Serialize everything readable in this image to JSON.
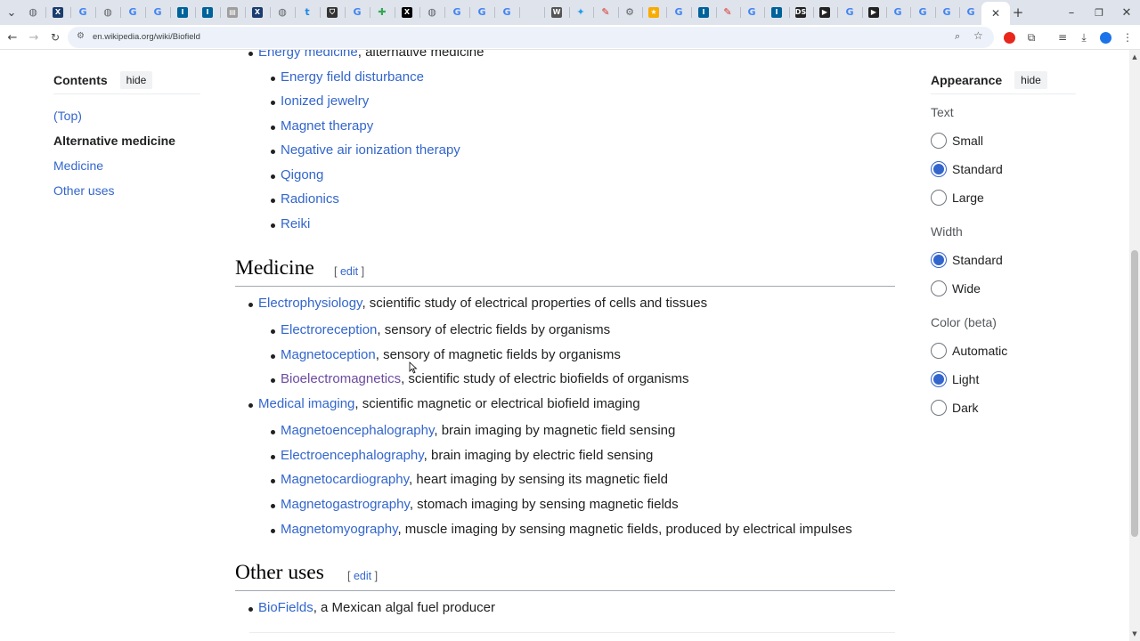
{
  "browser": {
    "url": "en.wikipedia.org/wiki/Biofield",
    "tabs": [
      {
        "icon": "globe-icon",
        "color": "#5f6368",
        "glyph": "◍"
      },
      {
        "icon": "app-x-dark-icon",
        "color": "#1a3c6e",
        "glyph": "X"
      },
      {
        "icon": "google-icon",
        "color": "#4285f4",
        "glyph": "G"
      },
      {
        "icon": "globe-icon",
        "color": "#5f6368",
        "glyph": "◍"
      },
      {
        "icon": "google-icon",
        "color": "#4285f4",
        "glyph": "G"
      },
      {
        "icon": "google-icon",
        "color": "#4285f4",
        "glyph": "G"
      },
      {
        "icon": "ieee-icon",
        "color": "#00629b",
        "glyph": "I"
      },
      {
        "icon": "ieee-icon",
        "color": "#00629b",
        "glyph": "I"
      },
      {
        "icon": "doc-icon",
        "color": "#9e9e9e",
        "glyph": "▤"
      },
      {
        "icon": "app-x-dark-icon",
        "color": "#1a3c6e",
        "glyph": "X"
      },
      {
        "icon": "globe-icon",
        "color": "#5f6368",
        "glyph": "◍"
      },
      {
        "icon": "text-t-icon",
        "color": "#1e88e5",
        "glyph": "t"
      },
      {
        "icon": "shield-icon",
        "color": "#333333",
        "glyph": "⛉"
      },
      {
        "icon": "google-icon",
        "color": "#4285f4",
        "glyph": "G"
      },
      {
        "icon": "puzzle-icon",
        "color": "#34a853",
        "glyph": "✚"
      },
      {
        "icon": "x-logo-icon",
        "color": "#000000",
        "glyph": "X"
      },
      {
        "icon": "globe-icon",
        "color": "#5f6368",
        "glyph": "◍"
      },
      {
        "icon": "google-icon",
        "color": "#4285f4",
        "glyph": "G"
      },
      {
        "icon": "google-icon",
        "color": "#4285f4",
        "glyph": "G"
      },
      {
        "icon": "google-icon",
        "color": "#4285f4",
        "glyph": "G"
      },
      {
        "icon": "blank-icon",
        "color": "#dfe3eb",
        "glyph": ""
      },
      {
        "icon": "wikipedia-icon",
        "color": "#555555",
        "glyph": "W"
      },
      {
        "icon": "bird-icon",
        "color": "#1d9bf0",
        "glyph": "✦"
      },
      {
        "icon": "pen-icon",
        "color": "#d93025",
        "glyph": "✎"
      },
      {
        "icon": "gear-icon",
        "color": "#5f6368",
        "glyph": "⚙"
      },
      {
        "icon": "star-badge-icon",
        "color": "#f9ab00",
        "glyph": "★"
      },
      {
        "icon": "google-icon",
        "color": "#4285f4",
        "glyph": "G"
      },
      {
        "icon": "ieee-icon",
        "color": "#00629b",
        "glyph": "I"
      },
      {
        "icon": "pen-icon",
        "color": "#d93025",
        "glyph": "✎"
      },
      {
        "icon": "google-icon",
        "color": "#4285f4",
        "glyph": "G"
      },
      {
        "icon": "ieee-icon",
        "color": "#00629b",
        "glyph": "I"
      },
      {
        "icon": "ds-icon",
        "color": "#222222",
        "glyph": "DS"
      },
      {
        "icon": "arrow-shape-icon",
        "color": "#222222",
        "glyph": "▶"
      },
      {
        "icon": "google-icon",
        "color": "#4285f4",
        "glyph": "G"
      },
      {
        "icon": "arrow-shape-icon",
        "color": "#222222",
        "glyph": "▶"
      },
      {
        "icon": "google-icon",
        "color": "#4285f4",
        "glyph": "G"
      },
      {
        "icon": "google-icon",
        "color": "#4285f4",
        "glyph": "G"
      },
      {
        "icon": "google-icon",
        "color": "#4285f4",
        "glyph": "G"
      },
      {
        "icon": "google-icon",
        "color": "#4285f4",
        "glyph": "G"
      }
    ],
    "active_tab_icon": "close-icon"
  },
  "toc": {
    "title": "Contents",
    "hide_label": "hide",
    "items": [
      {
        "label": "(Top)",
        "active": false
      },
      {
        "label": "Alternative medicine",
        "active": true
      },
      {
        "label": "Medicine",
        "active": false
      },
      {
        "label": "Other uses",
        "active": false
      }
    ]
  },
  "content": {
    "top_partial": {
      "link": "Energy medicine",
      "text": ", alternative medicine"
    },
    "alt_items": [
      "Energy field disturbance",
      "Ionized jewelry",
      "Magnet therapy",
      "Negative air ionization therapy",
      "Qigong",
      "Radionics",
      "Reiki"
    ],
    "medicine": {
      "heading": "Medicine",
      "edit": "edit",
      "items": [
        {
          "link": "Electrophysiology",
          "text": ", scientific study of electrical properties of cells and tissues"
        },
        {
          "link": "Electroreception",
          "text": ", sensory of electric fields by organisms"
        },
        {
          "link": "Magnetoception",
          "text": ", sensory of magnetic fields by organisms"
        },
        {
          "link": "Bioelectromagnetics",
          "text": ", scientific study of electric biofields of organisms"
        },
        {
          "link": "Medical imaging",
          "text": ", scientific magnetic or electrical biofield imaging"
        },
        {
          "link": "Magnetoencephalography",
          "text": ", brain imaging by magnetic field sensing"
        },
        {
          "link": "Electroencephalography",
          "text": ", brain imaging by electric field sensing"
        },
        {
          "link": "Magnetocardiography",
          "text": ", heart imaging by sensing its magnetic field"
        },
        {
          "link": "Magnetogastrography",
          "text": ", stomach imaging by sensing magnetic fields"
        },
        {
          "link": "Magnetomyography",
          "text": ", muscle imaging by sensing magnetic fields, produced by electrical impulses"
        }
      ]
    },
    "other_uses": {
      "heading": "Other uses",
      "edit": "edit",
      "items": [
        {
          "link": "BioFields",
          "text": ", a Mexican algal fuel producer"
        }
      ]
    }
  },
  "appearance": {
    "title": "Appearance",
    "hide_label": "hide",
    "text_label": "Text",
    "text_options": [
      {
        "label": "Small",
        "checked": false
      },
      {
        "label": "Standard",
        "checked": true
      },
      {
        "label": "Large",
        "checked": false
      }
    ],
    "width_label": "Width",
    "width_options": [
      {
        "label": "Standard",
        "checked": true
      },
      {
        "label": "Wide",
        "checked": false
      }
    ],
    "color_label": "Color (beta)",
    "color_options": [
      {
        "label": "Automatic",
        "checked": false
      },
      {
        "label": "Light",
        "checked": true
      },
      {
        "label": "Dark",
        "checked": false
      }
    ]
  },
  "colors": {
    "link": "#3366cc",
    "visited": "#6b4ba1",
    "text": "#202122",
    "accent": "#3366cc"
  }
}
